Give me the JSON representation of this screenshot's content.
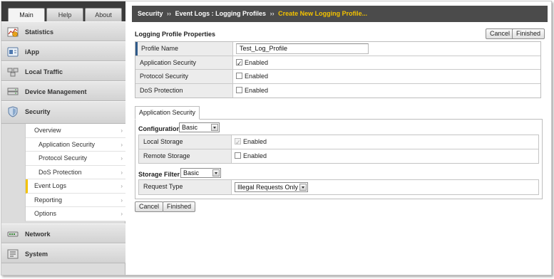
{
  "tabs": [
    "Main",
    "Help",
    "About"
  ],
  "nav": {
    "statistics": "Statistics",
    "iapp": "iApp",
    "local_traffic": "Local Traffic",
    "device_management": "Device Management",
    "security": "Security",
    "network": "Network",
    "system": "System"
  },
  "security_menu": [
    {
      "label": "Overview"
    },
    {
      "label": "Application Security"
    },
    {
      "label": "Protocol Security"
    },
    {
      "label": "DoS Protection"
    },
    {
      "label": "Event Logs"
    },
    {
      "label": "Reporting"
    },
    {
      "label": "Options"
    }
  ],
  "breadcrumb": {
    "part1": "Security",
    "sep": "››",
    "part2": "Event Logs : Logging Profiles",
    "current": "Create New Logging Profile..."
  },
  "properties": {
    "title": "Logging Profile Properties",
    "cancel": "Cancel",
    "finished": "Finished",
    "rows": [
      {
        "label": "Profile Name",
        "value": "Test_Log_Profile"
      },
      {
        "label": "Application Security",
        "value": "Enabled",
        "checked": true
      },
      {
        "label": "Protocol Security",
        "value": "Enabled",
        "checked": false
      },
      {
        "label": "DoS Protection",
        "value": "Enabled",
        "checked": false
      }
    ]
  },
  "app_security": {
    "tab": "Application Security",
    "configuration_label": "Configuration",
    "configuration_value": "Basic",
    "local_storage": {
      "label": "Local Storage",
      "value": "Enabled",
      "checked": true,
      "disabled": true
    },
    "remote_storage": {
      "label": "Remote Storage",
      "value": "Enabled",
      "checked": false
    },
    "storage_filter_label": "Storage Filter",
    "storage_filter_value": "Basic",
    "request_type": {
      "label": "Request Type",
      "value": "Illegal Requests Only"
    }
  },
  "bottom": {
    "cancel": "Cancel",
    "finished": "Finished"
  }
}
